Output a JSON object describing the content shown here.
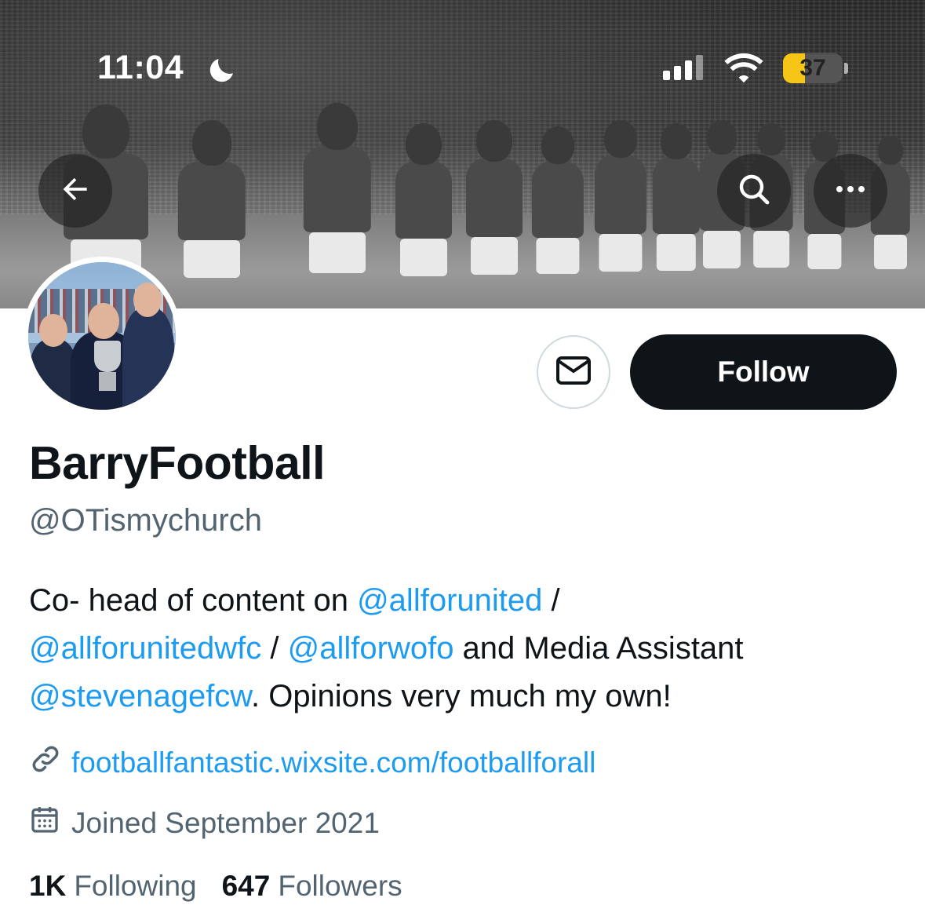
{
  "status_bar": {
    "time": "11:04",
    "battery_percent": 37,
    "battery_label": "37",
    "icons": [
      "moon-icon",
      "cellular-signal-icon",
      "wifi-icon",
      "battery-icon"
    ]
  },
  "header": {
    "back_icon": "arrow-left-icon",
    "search_icon": "search-icon",
    "more_icon": "more-dots-icon"
  },
  "actions": {
    "message_icon": "envelope-icon",
    "follow_label": "Follow"
  },
  "profile": {
    "display_name": "BarryFootball",
    "handle": "@OTismychurch",
    "bio": {
      "part1": "Co- head of content on ",
      "mention1": "@allforunited",
      "part2": " / ",
      "mention2": "@allforunitedwfc",
      "part3": " / ",
      "mention3": "@allforwofo",
      "part4": " and Media Assistant ",
      "mention4": "@stevenagefcw",
      "part5": ". Opinions very much my own!"
    },
    "website": "footballfantastic.wixsite.com/footballforall",
    "joined": "Joined September 2021",
    "following_count": "1K",
    "following_label": "Following",
    "followers_count": "647",
    "followers_label": "Followers"
  },
  "colors": {
    "accent": "#1d9bf0",
    "text_primary": "#0f1419",
    "text_secondary": "#536471",
    "follow_button": "#0f1419",
    "battery_fill": "#f5c518"
  }
}
